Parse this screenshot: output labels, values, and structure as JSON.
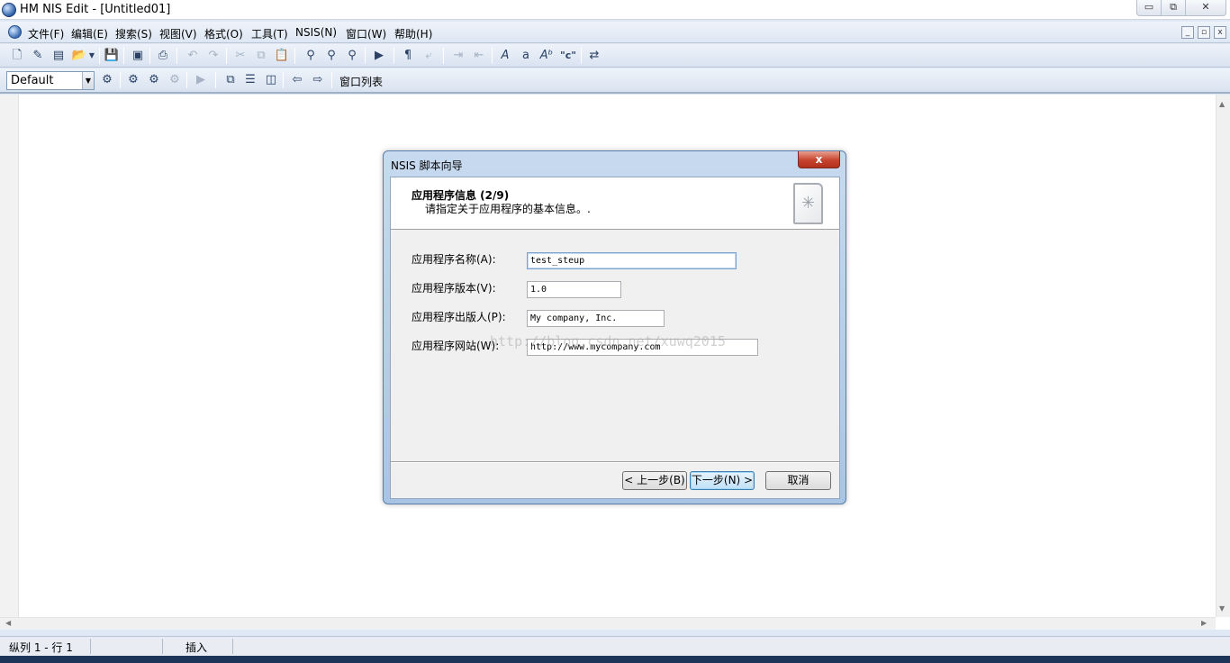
{
  "window": {
    "title": "HM NIS Edit - [Untitled01]",
    "controls": {
      "minimize": "▭",
      "restore": "⧉",
      "close": "✕"
    }
  },
  "menubar": {
    "items": [
      "文件(F)",
      "编辑(E)",
      "搜索(S)",
      "视图(V)",
      "格式(O)",
      "工具(T)",
      "NSIS(N)",
      "窗口(W)",
      "帮助(H)"
    ],
    "mdi_controls": [
      "_",
      "▫",
      "x"
    ]
  },
  "toolbar2": {
    "config_value": "Default",
    "window_list_label": "窗口列表"
  },
  "dialog": {
    "title": "NSIS 脚本向导",
    "close_label": "x",
    "header_title": "应用程序信息 (2/9)",
    "header_subtitle": "请指定关于应用程序的基本信息。.",
    "fields": [
      {
        "label": "应用程序名称(A):",
        "value": "test_steup"
      },
      {
        "label": "应用程序版本(V):",
        "value": "1.0"
      },
      {
        "label": "应用程序出版人(P):",
        "value": "My company, Inc."
      },
      {
        "label": "应用程序网站(W):",
        "value": "http://www.mycompany.com"
      }
    ],
    "buttons": {
      "back": "< 上一步(B)",
      "next": "下一步(N) >",
      "cancel": "取消"
    }
  },
  "watermark": "http://blog.csdn.net/xuwq2015",
  "statusbar": {
    "position": "纵列 1 - 行 1",
    "mode": "插入"
  },
  "icons": [
    "new-file-icon",
    "wizard-icon",
    "template-icon",
    "open-folder-icon",
    "save-icon",
    "save-all-icon",
    "print-icon",
    "undo-icon",
    "redo-icon",
    "cut-icon",
    "copy-icon",
    "paste-icon",
    "find-icon",
    "find-next-icon",
    "replace-icon",
    "insert-file-icon",
    "paragraph-icon",
    "word-wrap-icon",
    "indent-icon",
    "outdent-icon",
    "uppercase-icon",
    "lowercase-icon",
    "toggle-case-icon",
    "quote-icon",
    "format-icon"
  ]
}
